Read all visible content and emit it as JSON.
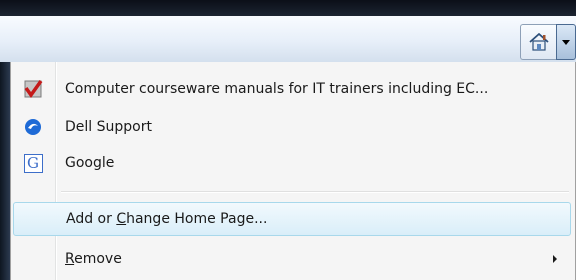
{
  "toolbar": {
    "home_button": {
      "icon": "home-icon"
    },
    "dropdown_button": {
      "icon": "chevron-down-icon"
    }
  },
  "menu": {
    "home_pages": [
      {
        "label": "Computer courseware manuals for IT trainers including EC...",
        "icon": "checkmark-page-icon"
      },
      {
        "label": "Dell Support",
        "icon": "dell-support-icon"
      },
      {
        "label": "Google",
        "icon": "google-g-icon"
      }
    ],
    "add_change": {
      "label_before": "Add or ",
      "accel": "C",
      "label_after": "hange Home Page..."
    },
    "remove": {
      "accel": "R",
      "label_after": "emove"
    }
  }
}
